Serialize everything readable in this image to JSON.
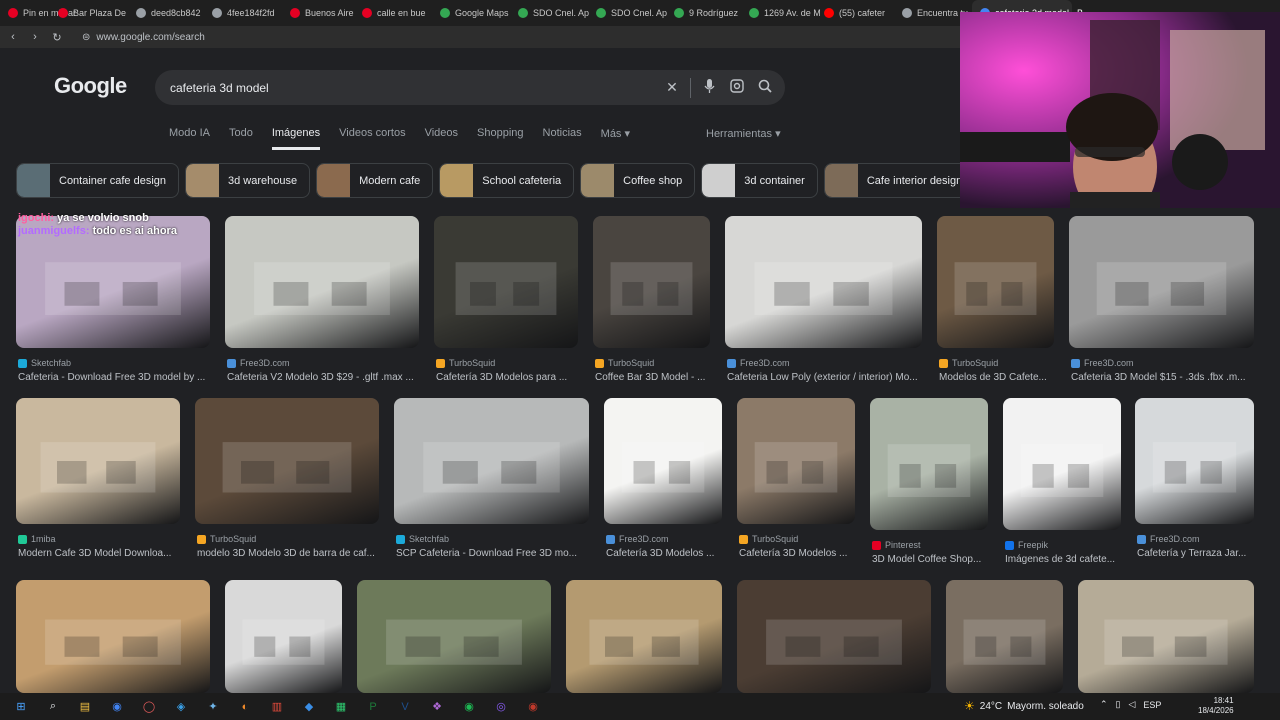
{
  "browser": {
    "tabs": [
      {
        "label": "Pin en mi bar",
        "color": "#e60023"
      },
      {
        "label": "Bar Plaza De",
        "color": "#e60023"
      },
      {
        "label": "deed8cb842",
        "color": "#9aa0a6"
      },
      {
        "label": "4fee184f2fd",
        "color": "#9aa0a6"
      },
      {
        "label": "Buenos Aire",
        "color": "#e60023"
      },
      {
        "label": "calle en bue",
        "color": "#e60023"
      },
      {
        "label": "Google Maps",
        "color": "#34a853"
      },
      {
        "label": "SDO Cnel. Ap",
        "color": "#34a853"
      },
      {
        "label": "SDO Cnel. Ap",
        "color": "#34a853"
      },
      {
        "label": "9 Rodríguez",
        "color": "#34a853"
      },
      {
        "label": "1269 Av. de M",
        "color": "#34a853"
      },
      {
        "label": "(55) cafeter",
        "color": "#ff0000"
      },
      {
        "label": "Encuentra tu",
        "color": "#9aa0a6"
      },
      {
        "label": "cafeteria 3d model - B",
        "color": "#4285f4"
      }
    ],
    "url": "www.google.com/search",
    "back": "‹",
    "forward": "›",
    "reload": "↻",
    "lock": "⊜"
  },
  "google": {
    "logo": "Google",
    "query": "cafeteria 3d model",
    "nav_tabs": [
      "Modo IA",
      "Todo",
      "Imágenes",
      "Videos cortos",
      "Videos",
      "Shopping",
      "Noticias",
      "Más ▾"
    ],
    "tools": "Herramientas ▾",
    "chips": [
      {
        "label": "Container cafe design",
        "color": "#5a6d75"
      },
      {
        "label": "3d warehouse",
        "color": "#a58c6b"
      },
      {
        "label": "Modern cafe",
        "color": "#8b6a4e"
      },
      {
        "label": "School cafeteria",
        "color": "#b89a63"
      },
      {
        "label": "Coffee shop",
        "color": "#9c8a6b"
      },
      {
        "label": "3d container",
        "color": "#cfcfcf"
      },
      {
        "label": "Cafe interior design",
        "color": "#7d6b58"
      }
    ]
  },
  "results": [
    {
      "source": "Sketchfab",
      "title": "Cafeteria - Download Free 3D model by ...",
      "src_color": "#1caad9",
      "bg": "#b9a7c2"
    },
    {
      "source": "Free3D.com",
      "title": "Cafeteria V2 Modelo 3D $29 - .gltf .max ...",
      "src_color": "#4a90d9",
      "bg": "#c6c8c2"
    },
    {
      "source": "TurboSquid",
      "title": "Cafetería 3D Modelos para ...",
      "src_color": "#f5a623",
      "bg": "#3a3a34"
    },
    {
      "source": "TurboSquid",
      "title": "Coffee Bar 3D Model - ...",
      "src_color": "#f5a623",
      "bg": "#4a4540"
    },
    {
      "source": "Free3D.com",
      "title": "Cafeteria Low Poly (exterior / interior) Mo...",
      "src_color": "#4a90d9",
      "bg": "#d7d7d5"
    },
    {
      "source": "TurboSquid",
      "title": "Modelos de 3D Cafete...",
      "src_color": "#f5a623",
      "bg": "#6e5a45"
    },
    {
      "source": "Free3D.com",
      "title": "Cafeteria 3D Model $15 - .3ds .fbx .m...",
      "src_color": "#4a90d9",
      "bg": "#9a9a9a"
    },
    {
      "source": "1miba",
      "title": "Modern Cafe 3D Model Downloa...",
      "src_color": "#20c997",
      "bg": "#c9b89e"
    },
    {
      "source": "TurboSquid",
      "title": "modelo 3D Modelo 3D de barra de caf...",
      "src_color": "#f5a623",
      "bg": "#5c4a3a"
    },
    {
      "source": "Sketchfab",
      "title": "SCP Cafeteria - Download Free 3D mo...",
      "src_color": "#1caad9",
      "bg": "#b7b9b9"
    },
    {
      "source": "Free3D.com",
      "title": "Cafetería 3D Modelos ...",
      "src_color": "#4a90d9",
      "bg": "#f4f4f2"
    },
    {
      "source": "TurboSquid",
      "title": "Cafetería 3D Modelos ...",
      "src_color": "#f5a623",
      "bg": "#8c7a68"
    },
    {
      "source": "Pinterest",
      "title": "3D Model Coffee Shop...",
      "src_color": "#e60023",
      "bg": "#a9b2a5"
    },
    {
      "source": "Freepik",
      "title": "Imágenes de 3d cafete...",
      "src_color": "#1273eb",
      "bg": "#f2f2f2"
    },
    {
      "source": "Free3D.com",
      "title": "Cafetería y Terraza Jar...",
      "src_color": "#4a90d9",
      "bg": "#d6d9db"
    },
    {
      "source": "",
      "title": "",
      "src_color": "#888888",
      "bg": "#c39d6e"
    },
    {
      "source": "",
      "title": "",
      "src_color": "#888888",
      "bg": "#d9d9d9"
    },
    {
      "source": "",
      "title": "",
      "src_color": "#888888",
      "bg": "#6d7a5a"
    },
    {
      "source": "",
      "title": "",
      "src_color": "#888888",
      "bg": "#b49a70"
    },
    {
      "source": "",
      "title": "",
      "src_color": "#888888",
      "bg": "#4b3d33"
    },
    {
      "source": "",
      "title": "",
      "src_color": "#888888",
      "bg": "#7a6e61"
    },
    {
      "source": "",
      "title": "",
      "src_color": "#888888",
      "bg": "#b5ab97"
    }
  ],
  "chat": [
    {
      "user": "igochi:",
      "msg": "ya se volvio snob",
      "color": "#ff5fa0"
    },
    {
      "user": "juanmiguelfs:",
      "msg": "todo es ai ahora",
      "color": "#b36bff"
    }
  ],
  "taskbar": {
    "weather_temp": "24°C",
    "weather_desc": "Mayorm. soleado",
    "lang": "ESP",
    "time": "18:41",
    "date": "18/4/2026",
    "apps": [
      "⊞",
      "⌕",
      "▤",
      "◉",
      "◯",
      "◈",
      "✦",
      "◐",
      "▥",
      "◆",
      "▦",
      "P",
      "V",
      "❖",
      "◉",
      "◎",
      "◉"
    ]
  }
}
